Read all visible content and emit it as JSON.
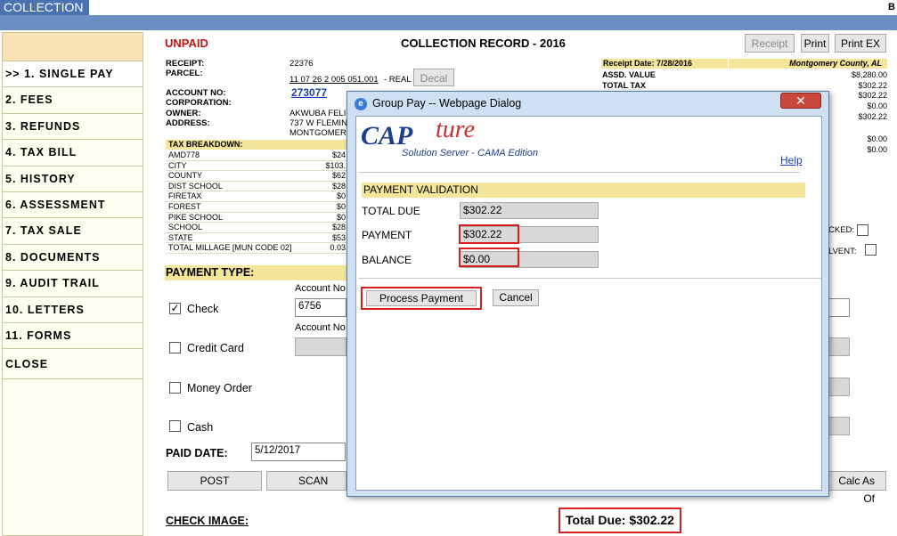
{
  "topbar": {
    "tab": "COLLECTION",
    "corner": "B"
  },
  "sidebar": {
    "items": [
      {
        "label": ">> 1. SINGLE PAY",
        "name": "sidebar-item-single-pay"
      },
      {
        "label": "2. FEES",
        "name": "sidebar-item-fees"
      },
      {
        "label": "3. REFUNDS",
        "name": "sidebar-item-refunds"
      },
      {
        "label": "4. TAX BILL",
        "name": "sidebar-item-tax-bill"
      },
      {
        "label": "5. HISTORY",
        "name": "sidebar-item-history"
      },
      {
        "label": "6. ASSESSMENT",
        "name": "sidebar-item-assessment"
      },
      {
        "label": "7. TAX SALE",
        "name": "sidebar-item-tax-sale"
      },
      {
        "label": "8. DOCUMENTS",
        "name": "sidebar-item-documents"
      },
      {
        "label": "9. AUDIT TRAIL",
        "name": "sidebar-item-audit-trail"
      },
      {
        "label": "10. LETTERS",
        "name": "sidebar-item-letters"
      },
      {
        "label": "11. FORMS",
        "name": "sidebar-item-forms"
      }
    ],
    "close": "CLOSE"
  },
  "header": {
    "status": "UNPAID",
    "title": "COLLECTION RECORD - 2016",
    "receipt_btn": "Receipt",
    "print_btn": "Print",
    "print_ex_btn": "Print EX"
  },
  "record": {
    "receipt_label": "RECEIPT:",
    "receipt_value": "22376",
    "parcel_label": "PARCEL:",
    "parcel_value": "11 07 26 2 005 051.001",
    "parcel_type": "- REAL",
    "decal_btn": "Decal",
    "account_label": "ACCOUNT NO:",
    "account_value": "273077",
    "corporation_label": "CORPORATION:",
    "owner_label": "OWNER:",
    "owner_value": "AKWUBA FELI",
    "address_label": "ADDRESS:",
    "address_line1": "737 W FLEMIN",
    "address_line2": "MONTGOMER"
  },
  "tax_breakdown": {
    "header": "TAX BREAKDOWN:",
    "rows": [
      {
        "name": "AMD778",
        "value": "$24"
      },
      {
        "name": "CITY",
        "value": "$103."
      },
      {
        "name": "COUNTY",
        "value": "$62"
      },
      {
        "name": "DIST SCHOOL",
        "value": "$28"
      },
      {
        "name": "FIRETAX",
        "value": "$0"
      },
      {
        "name": "FOREST",
        "value": "$0"
      },
      {
        "name": "PIKE SCHOOL",
        "value": "$0"
      },
      {
        "name": "SCHOOL",
        "value": "$28"
      },
      {
        "name": "STATE",
        "value": "$53"
      },
      {
        "name": "TOTAL MILLAGE [MUN CODE 02]",
        "value": "0.03"
      }
    ]
  },
  "right_panel": {
    "receipt_date": "Receipt Date: 7/28/2016",
    "county": "Montgomery County, AL",
    "assd_value_label": "ASSD. VALUE",
    "assd_value": "$8,280.00",
    "total_tax_label": "TOTAL TAX",
    "values": [
      "$302.22",
      "$302.22",
      "$0.00",
      "$302.22",
      "$0.00",
      "$0.00"
    ],
    "checked_label": "CKED:",
    "solvent_label": "LVENT:"
  },
  "payment": {
    "section_label": "PAYMENT TYPE:",
    "account_no_label": "Account No",
    "check_label": "Check",
    "check_account": "6756",
    "credit_card_label": "Credit Card",
    "money_order_label": "Money Order",
    "cash_label": "Cash",
    "paid_date_label": "PAID DATE:",
    "paid_date": "5/12/2017",
    "post_btn": "POST",
    "scan_btn": "SCAN",
    "calc_btn": "Calc As Of",
    "check_image_label": "CHECK IMAGE:",
    "total_due": "Total Due: $302.22"
  },
  "dialog": {
    "title": "Group Pay -- Webpage Dialog",
    "logo_cap": "CAP",
    "logo_ture": "ture",
    "logo_sub": "Solution Server - CAMA Edition",
    "help": "Help",
    "section": "PAYMENT VALIDATION",
    "total_due_label": "TOTAL DUE",
    "total_due": "$302.22",
    "payment_label": "PAYMENT",
    "payment": "$302.22",
    "balance_label": "BALANCE",
    "balance": "$0.00",
    "process_btn": "Process Payment",
    "cancel_btn": "Cancel",
    "close_glyph": "✕"
  }
}
